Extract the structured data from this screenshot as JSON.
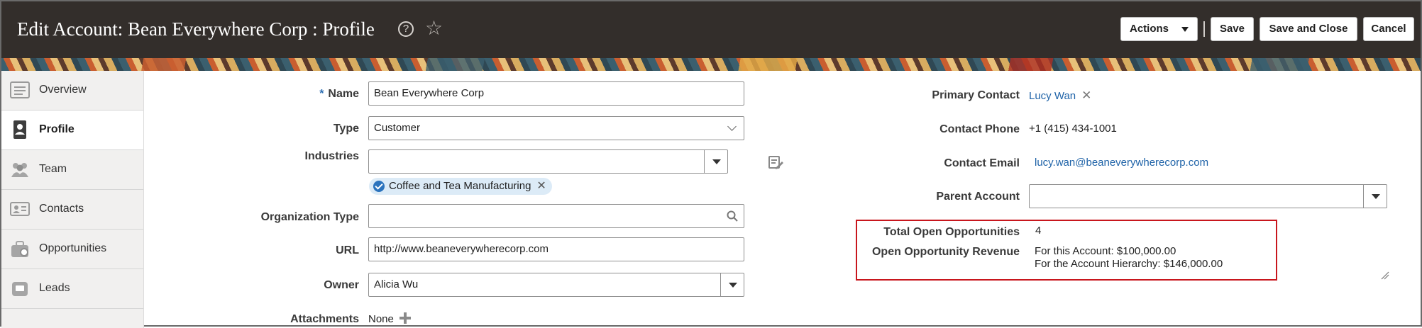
{
  "header": {
    "title": "Edit Account: Bean Everywhere Corp : Profile",
    "help_icon": "help-circle-icon",
    "favorite_icon": "star-outline-icon",
    "actions_label": "Actions",
    "save_label": "Save",
    "save_close_label": "Save and Close",
    "cancel_label": "Cancel",
    "bg_color": "#332e2b"
  },
  "sidebar": {
    "items": [
      {
        "label": "Overview",
        "icon": "overview-icon",
        "active": false
      },
      {
        "label": "Profile",
        "icon": "profile-icon",
        "active": true
      },
      {
        "label": "Team",
        "icon": "team-icon",
        "active": false
      },
      {
        "label": "Contacts",
        "icon": "contacts-icon",
        "active": false
      },
      {
        "label": "Opportunities",
        "icon": "opportunities-icon",
        "active": false
      },
      {
        "label": "Leads",
        "icon": "leads-icon",
        "active": false
      }
    ]
  },
  "form": {
    "required_marker": "*",
    "name_label": "Name",
    "name_value": "Bean Everywhere Corp",
    "type_label": "Type",
    "type_value": "Customer",
    "industries_label": "Industries",
    "industries_value": "",
    "industry_chip": "Coffee and Tea Manufacturing",
    "org_type_label": "Organization Type",
    "org_type_value": "",
    "url_label": "URL",
    "url_value": "http://www.beaneverywherecorp.com",
    "owner_label": "Owner",
    "owner_value": "Alicia Wu",
    "attachments_label": "Attachments",
    "attachments_value": "None"
  },
  "details": {
    "primary_contact_label": "Primary Contact",
    "primary_contact_value": "Lucy Wan",
    "contact_phone_label": "Contact Phone",
    "contact_phone_value": "+1 (415) 434-1001",
    "contact_email_label": "Contact Email",
    "contact_email_value": "lucy.wan@beaneverywherecorp.com",
    "parent_account_label": "Parent Account",
    "parent_account_value": "",
    "total_open_opps_label": "Total Open Opportunities",
    "total_open_opps_value": "4",
    "open_opp_revenue_label": "Open Opportunity Revenue",
    "revenue_account": "For this Account: $100,000.00",
    "revenue_hierarchy": "For the Account Hierarchy: $146,000.00"
  },
  "colors": {
    "highlight_box": "#c8161d",
    "link": "#1f63a8",
    "required": "#2e6fb3"
  }
}
